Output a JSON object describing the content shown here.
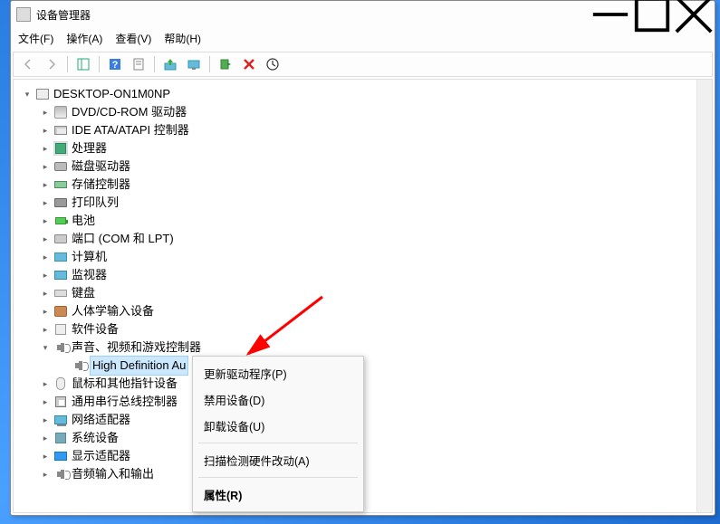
{
  "window": {
    "title": "设备管理器"
  },
  "menu": {
    "file": "文件(F)",
    "action": "操作(A)",
    "view": "查看(V)",
    "help": "帮助(H)"
  },
  "root": {
    "name": "DESKTOP-ON1M0NP"
  },
  "categories": {
    "dvd": "DVD/CD-ROM 驱动器",
    "ide": "IDE ATA/ATAPI 控制器",
    "cpu": "处理器",
    "disk": "磁盘驱动器",
    "memory": "存储控制器",
    "printer": "打印队列",
    "battery": "电池",
    "port": "端口 (COM 和 LPT)",
    "computer": "计算机",
    "monitor": "监视器",
    "keyboard": "键盘",
    "hid": "人体学输入设备",
    "soft": "软件设备",
    "sound": "声音、视频和游戏控制器",
    "sound_child": "High Definition Au",
    "mouse": "鼠标和其他指针设备",
    "usb": "通用串行总线控制器",
    "network": "网络适配器",
    "system": "系统设备",
    "display": "显示适配器",
    "audio_io": "音频输入和输出"
  },
  "context": {
    "update": "更新驱动程序(P)",
    "disable": "禁用设备(D)",
    "uninstall": "卸载设备(U)",
    "scan": "扫描检测硬件改动(A)",
    "properties": "属性(R)"
  }
}
